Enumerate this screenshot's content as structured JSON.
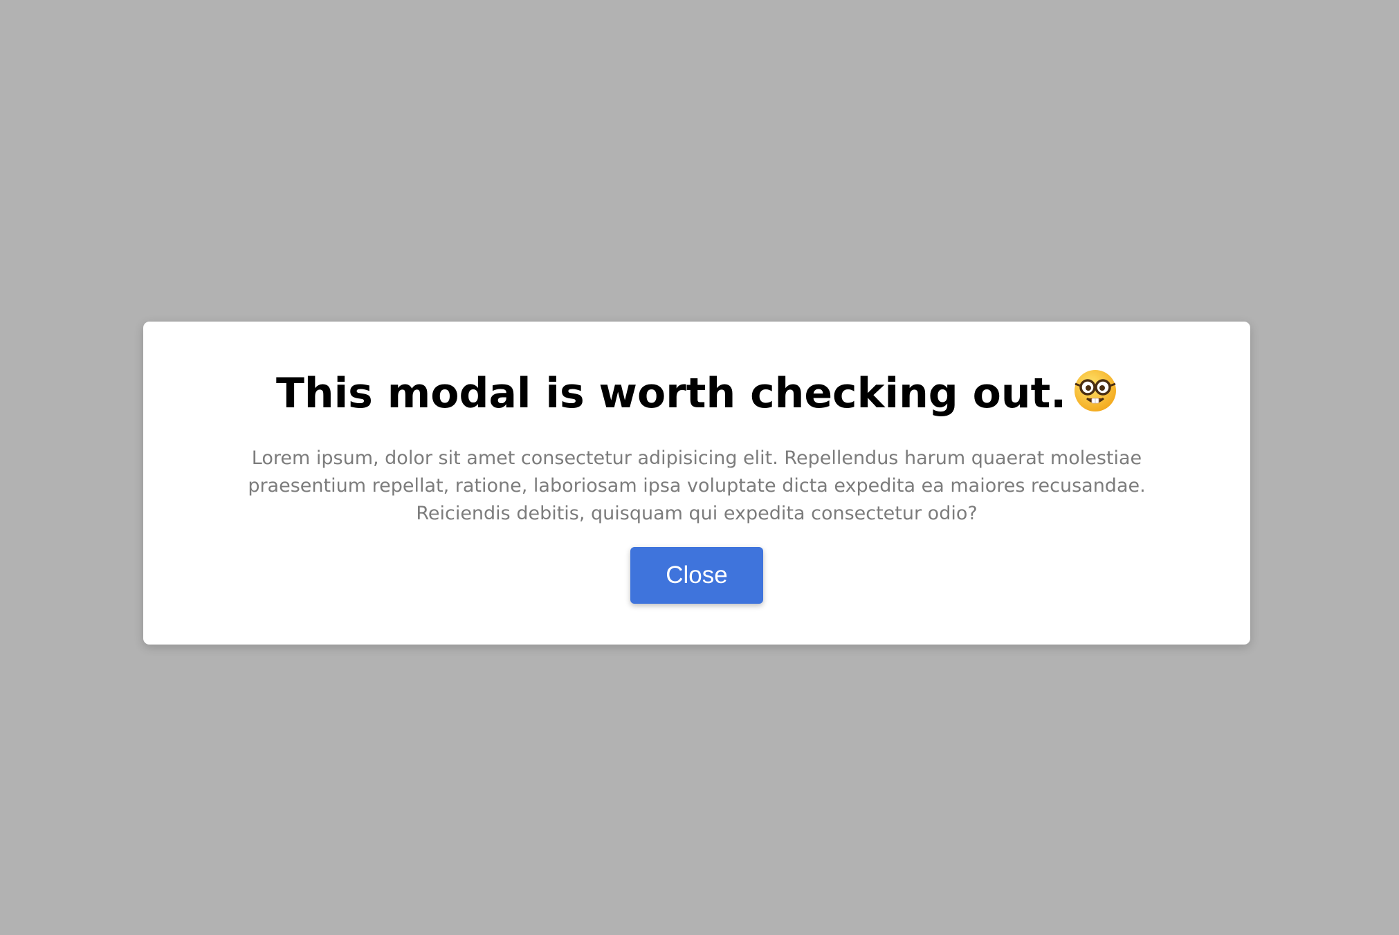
{
  "modal": {
    "title": "This modal is worth checking out.",
    "title_emoji_icon": "nerd-face-icon",
    "body": "Lorem ipsum, dolor sit amet consectetur adipisicing elit. Repellendus harum quaerat molestiae praesentium repellat, ratione, laboriosam ipsa voluptate dicta expedita ea maiores recusandae. Reiciendis debitis, quisquam qui expedita consectetur odio?",
    "close_label": "Close"
  },
  "colors": {
    "backdrop": "#b2b2b2",
    "modal_background": "#ffffff",
    "title": "#000000",
    "body_text": "#7c7c7c",
    "button_background": "#3f74dc",
    "button_text": "#ffffff"
  }
}
